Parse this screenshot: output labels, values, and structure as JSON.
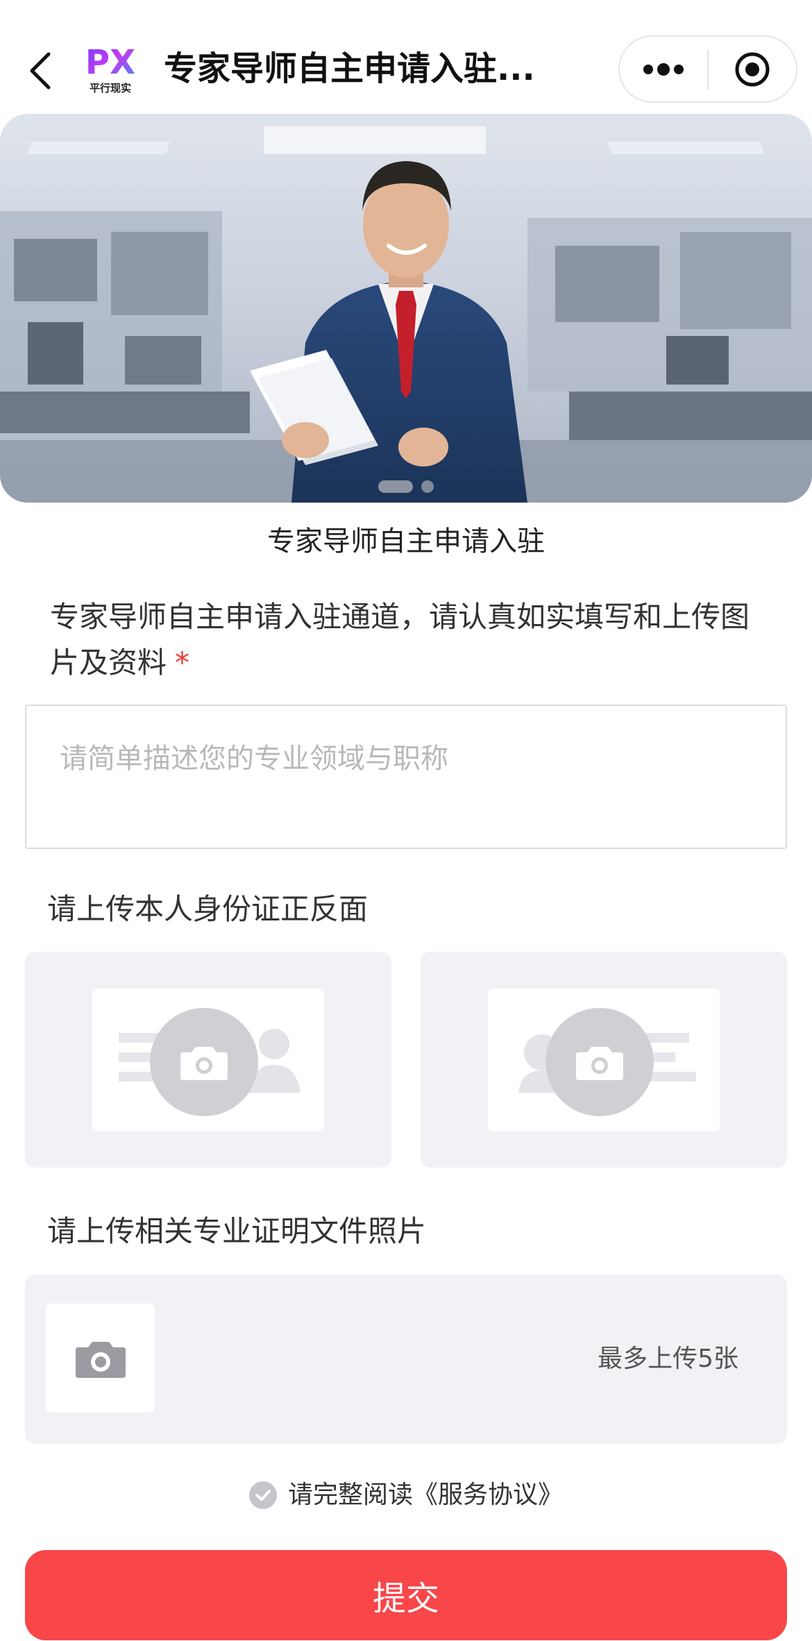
{
  "nav": {
    "title": "专家导师自主申请入驻...",
    "logo_text": "PX",
    "logo_subtitle": "平行现实",
    "back_icon": "chevron-left-icon",
    "more_icon": "more-dots-icon",
    "close_icon": "target-circle-icon"
  },
  "banner": {
    "slide_count": 2,
    "active_slide": 1,
    "image": "banner-image"
  },
  "form": {
    "title": "专家导师自主申请入驻",
    "question": "专家导师自主申请入驻通道，请认真如实填写和上传图片及资料",
    "required_mark": "*",
    "textarea_placeholder": "请简单描述您的专业领域与职称",
    "id_label": "请上传本人身份证正反面",
    "cert_label": "请上传相关专业证明文件照片",
    "upload_limit": "最多上传5张",
    "agreement": "请完整阅读《服务协议》",
    "submit": "提交"
  },
  "colors": {
    "accent": "#f84649",
    "required": "#e83a3a",
    "upload_bg": "#f0f2f5"
  }
}
